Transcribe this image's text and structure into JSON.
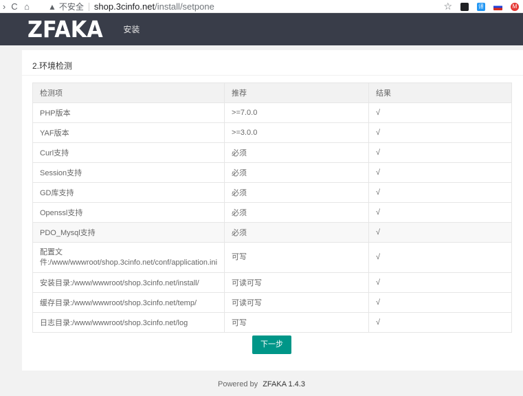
{
  "browser": {
    "back_icon": "back-arrow-icon",
    "reload": "C",
    "home": "⌂",
    "warning": "▲",
    "insecure_label": "不安全",
    "url_host": "shop.3cinfo.net",
    "url_path": "/install/setpone",
    "star": "☆",
    "translate_ext": "译",
    "red_ext": "M"
  },
  "header": {
    "logo": "ZFAKA",
    "nav_install": "安装"
  },
  "panel": {
    "step_title": "2.环境检测",
    "columns": [
      "检测项",
      "推荐",
      "结果"
    ],
    "rows": [
      {
        "item": "PHP版本",
        "recommend": ">=7.0.0",
        "result": "√"
      },
      {
        "item": "YAF版本",
        "recommend": ">=3.0.0",
        "result": "√"
      },
      {
        "item": "Curl支持",
        "recommend": "必须",
        "result": "√"
      },
      {
        "item": "Session支持",
        "recommend": "必须",
        "result": "√"
      },
      {
        "item": "GD库支持",
        "recommend": "必须",
        "result": "√"
      },
      {
        "item": "Openssl支持",
        "recommend": "必须",
        "result": "√"
      },
      {
        "item": "PDO_Mysql支持",
        "recommend": "必须",
        "result": "√"
      },
      {
        "item_line1": "配置文",
        "item_line2": "件:/www/wwwroot/shop.3cinfo.net/conf/application.ini",
        "recommend": "可写",
        "result": "√"
      },
      {
        "item": "安装目录:/www/wwwroot/shop.3cinfo.net/install/",
        "recommend": "可读可写",
        "result": "√"
      },
      {
        "item": "缓存目录:/www/wwwroot/shop.3cinfo.net/temp/",
        "recommend": "可读可写",
        "result": "√"
      },
      {
        "item": "日志目录:/www/wwwroot/shop.3cinfo.net/log",
        "recommend": "可写",
        "result": "√"
      }
    ],
    "next_button": "下一步"
  },
  "footer": {
    "powered_by": "Powered by",
    "brand": "ZFAKA 1.4.3"
  },
  "colors": {
    "header_bg": "#393d49",
    "button_bg": "#009688",
    "page_bg": "#f2f2f2"
  }
}
